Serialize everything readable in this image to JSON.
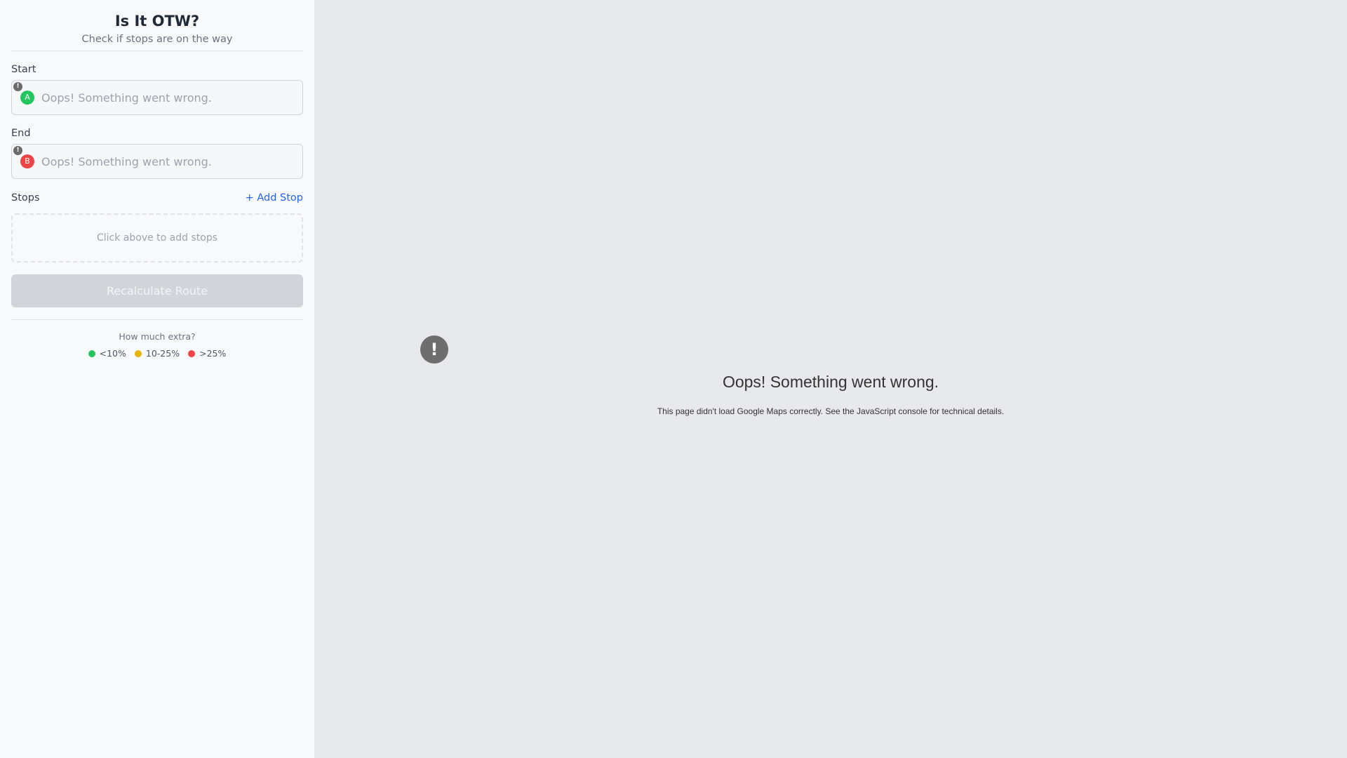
{
  "header": {
    "title": "Is It OTW?",
    "subtitle": "Check if stops are on the way"
  },
  "start": {
    "label": "Start",
    "marker": "A",
    "placeholder": "Oops! Something went wrong.",
    "warning_glyph": "!"
  },
  "end": {
    "label": "End",
    "marker": "B",
    "placeholder": "Oops! Something went wrong.",
    "warning_glyph": "!"
  },
  "stops": {
    "label": "Stops",
    "add_label": "+ Add Stop",
    "empty_text": "Click above to add stops"
  },
  "recalculate_label": "Recalculate Route",
  "legend": {
    "title": "How much extra?",
    "items": [
      {
        "label": "<10%",
        "color": "#22c55e"
      },
      {
        "label": "10-25%",
        "color": "#eab308"
      },
      {
        "label": ">25%",
        "color": "#ef4444"
      }
    ]
  },
  "map_error": {
    "icon": "!",
    "title": "Oops! Something went wrong.",
    "message": "This page didn't load Google Maps correctly. See the JavaScript console for technical details."
  }
}
